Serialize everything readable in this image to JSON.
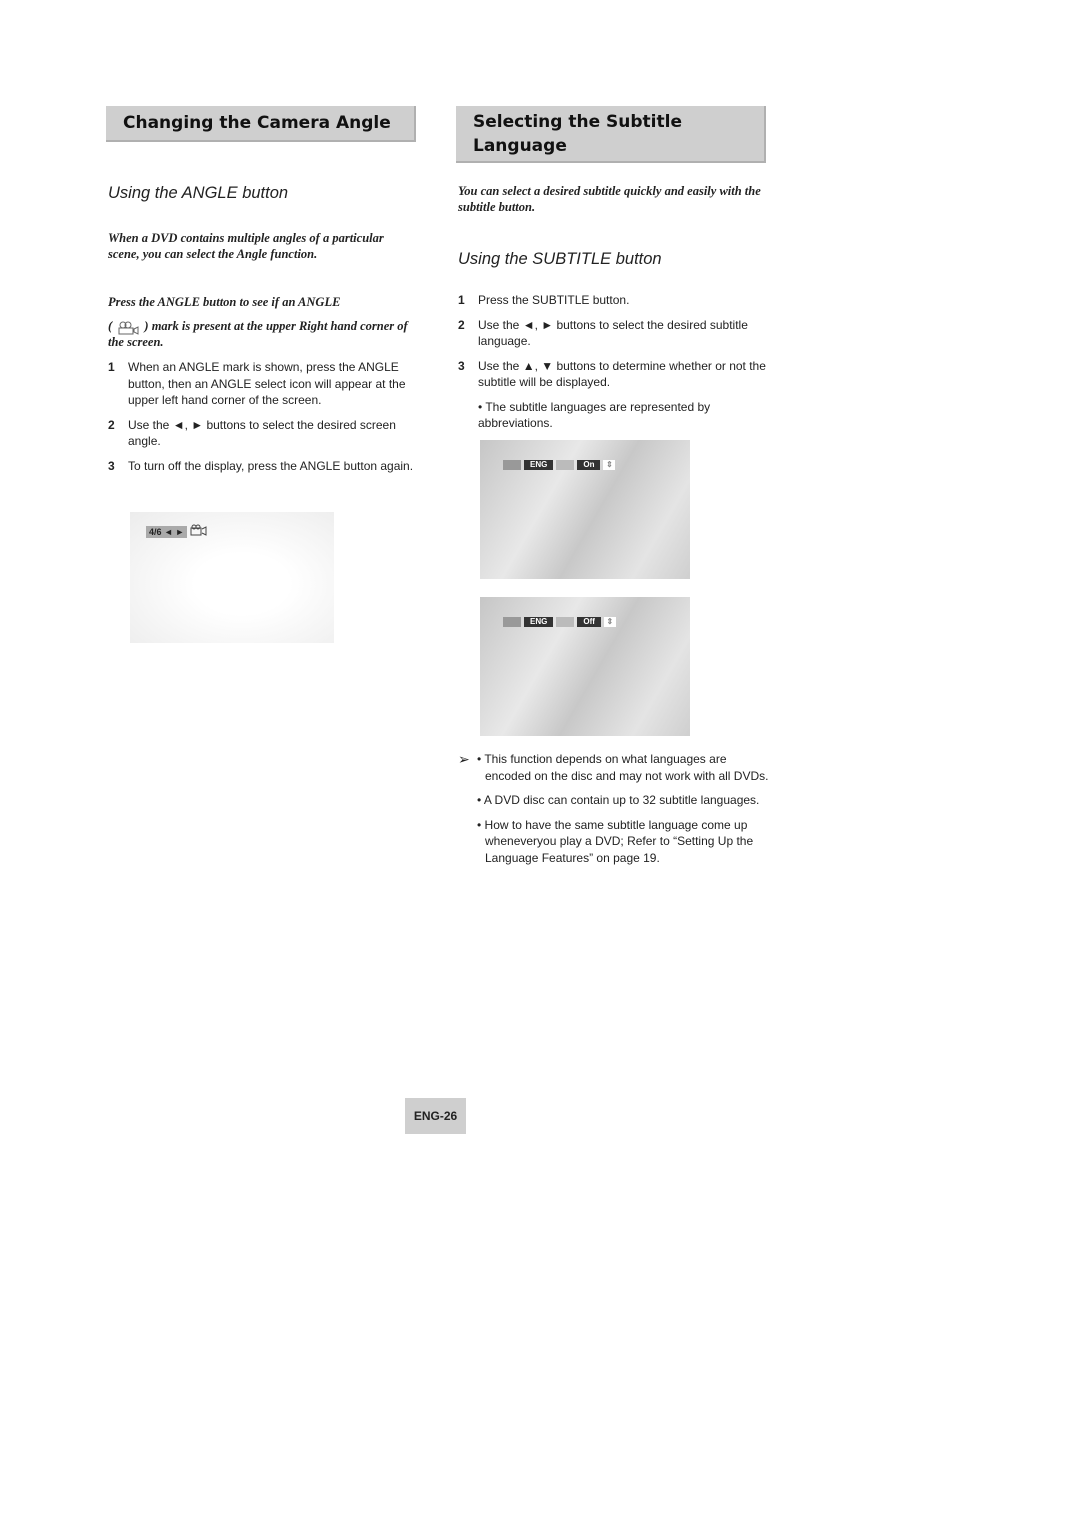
{
  "left": {
    "title": "Changing the Camera Angle",
    "subtitle": "Using the ANGLE button",
    "intro": "When a DVD contains multiple angles of a particular scene, you can select the Angle function.",
    "press_line1": "Press the ANGLE button to see if an ANGLE",
    "press_line2_open": "(",
    "press_line2": ") mark is present at the upper Right hand corner of the screen.",
    "steps": [
      {
        "num": "1",
        "text": "When an ANGLE mark is shown, press the ANGLE button, then an ANGLE select icon will appear at the upper left hand corner of the screen."
      },
      {
        "num": "2",
        "text": "Use the ◄, ► buttons to select the desired screen angle."
      },
      {
        "num": "3",
        "text": "To turn off the display, press the ANGLE button again."
      }
    ],
    "screen_osd": "4/6 ◄ ►"
  },
  "right": {
    "title": "Selecting the Subtitle Language",
    "intro": "You can select a desired subtitle quickly and easily with the subtitle button.",
    "subtitle": "Using the SUBTITLE button",
    "steps": [
      {
        "num": "1",
        "text": "Press the SUBTITLE button."
      },
      {
        "num": "2",
        "text": "Use the ◄, ► buttons to select the desired subtitle language."
      },
      {
        "num": "3",
        "text": "Use the ▲, ▼ buttons to determine whether or not the subtitle will be displayed."
      }
    ],
    "bullet": "• The subtitle languages are represented by abbreviations.",
    "screens": [
      {
        "lang": "ENG",
        "state": "On"
      },
      {
        "lang": "ENG",
        "state": "Off"
      }
    ],
    "note_icon": "➢",
    "notes": [
      "• This function depends on what languages are encoded on the disc and may not work with all DVDs.",
      "• A DVD disc can contain up to 32 subtitle languages.",
      "• How to have the same subtitle language come up wheneveryou play a DVD; Refer to “Setting Up the Language Features” on page 19."
    ]
  },
  "page_number": "ENG-26"
}
